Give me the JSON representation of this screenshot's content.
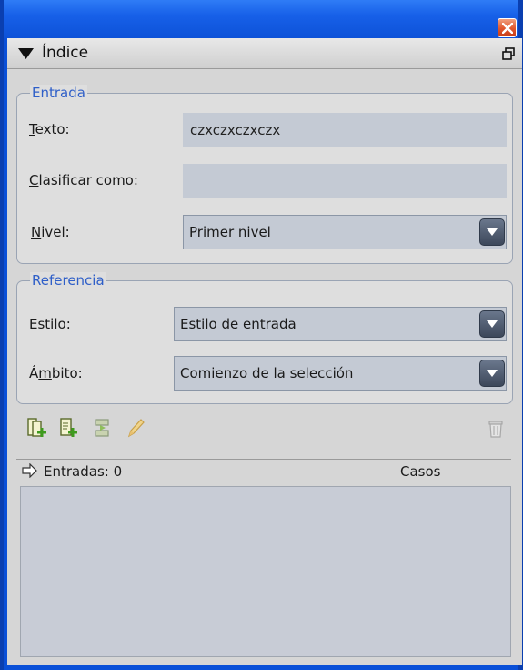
{
  "panel": {
    "title": "Índice"
  },
  "entry_group": {
    "legend": "Entrada",
    "text_label_first": "T",
    "text_label_rest": "exto:",
    "text_value": "czxczxczxczx",
    "sort_label_first": "C",
    "sort_label_rest": "lasificar como:",
    "sort_value": "",
    "level_label_first": "N",
    "level_label_rest": "ivel:",
    "level_value": "Primer nivel"
  },
  "reference_group": {
    "legend": "Referencia",
    "style_label_first": "E",
    "style_label_rest": "stilo:",
    "style_value": "Estilo de entrada",
    "scope_label_first": "Á",
    "scope_label_mid": "m",
    "scope_label_rest": "bito:",
    "scope_value": "Comienzo de la selección"
  },
  "list": {
    "entries_label": "Entradas: 0",
    "cases_label": "Casos"
  },
  "icons": {
    "close": "close-icon",
    "collapse": "triangle-down-icon",
    "detach": "detach-panel-icon",
    "new_entry": "new-entry-icon",
    "new_page_reference": "new-page-reference-icon",
    "go_to_reference": "go-to-reference-icon",
    "edit": "pencil-icon",
    "delete": "trash-icon",
    "entries_arrow": "arrow-right-icon"
  },
  "colors": {
    "title_bar": "#0d52d8",
    "legend_text": "#2f5fc8",
    "close_button": "#e0552c",
    "input_background": "#c4cad4"
  }
}
